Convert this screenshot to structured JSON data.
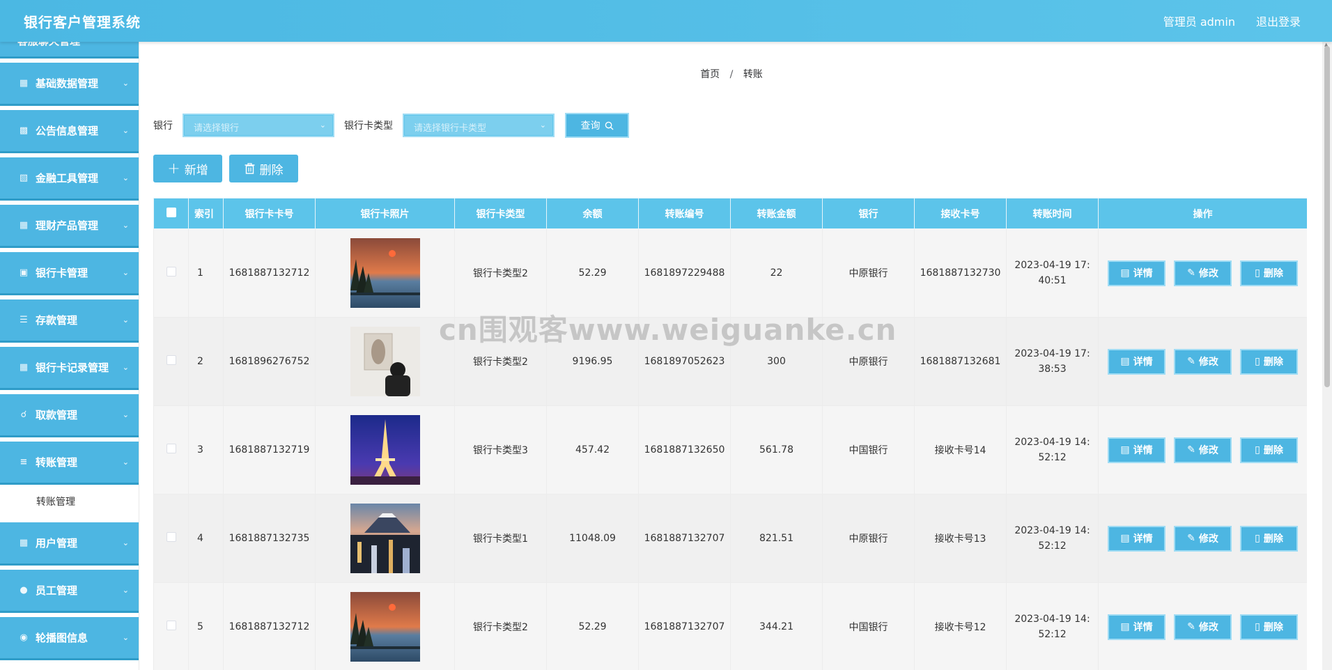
{
  "header": {
    "title": "银行客户管理系统",
    "user": "管理员 admin",
    "logout": "退出登录"
  },
  "sidebar": {
    "partial_label": "客服聊天管理",
    "items": [
      {
        "label": "基础数据管理",
        "icon": "grid-icon"
      },
      {
        "label": "公告信息管理",
        "icon": "document-icon"
      },
      {
        "label": "金融工具管理",
        "icon": "tool-icon"
      },
      {
        "label": "理财产品管理",
        "icon": "grid-icon"
      },
      {
        "label": "银行卡管理",
        "icon": "card-icon"
      },
      {
        "label": "存款管理",
        "icon": "list-icon"
      },
      {
        "label": "银行卡记录管理",
        "icon": "grid-icon"
      },
      {
        "label": "取款管理",
        "icon": "hand-icon"
      },
      {
        "label": "转账管理",
        "icon": "sliders-icon"
      },
      {
        "label": "用户管理",
        "icon": "grid-icon"
      },
      {
        "label": "员工管理",
        "icon": "user-icon"
      },
      {
        "label": "轮播图信息",
        "icon": "location-icon"
      }
    ],
    "submenu_label": "转账管理"
  },
  "breadcrumb": {
    "home": "首页",
    "sep": "/",
    "current": "转账"
  },
  "filters": {
    "bank_label": "银行",
    "bank_placeholder": "请选择银行",
    "card_type_label": "银行卡类型",
    "card_type_placeholder": "请选择银行卡类型",
    "search_label": "查询"
  },
  "actions": {
    "add": "新增",
    "delete": "删除"
  },
  "table": {
    "columns": [
      "索引",
      "银行卡卡号",
      "银行卡照片",
      "银行卡类型",
      "余额",
      "转账编号",
      "转账金额",
      "银行",
      "接收卡号",
      "转账时间",
      "操作"
    ],
    "op_labels": {
      "detail": "详情",
      "edit": "修改",
      "delete": "删除"
    },
    "rows": [
      {
        "index": "1",
        "card_no": "1681887132712",
        "photo": "sunset-lake-photo",
        "card_type": "银行卡类型2",
        "balance": "52.29",
        "transfer_no": "1681897229488",
        "amount": "22",
        "bank": "中原银行",
        "receiver": "1681887132730",
        "time": "2023-04-19 17:40:51"
      },
      {
        "index": "2",
        "card_no": "1681896276752",
        "photo": "person-gallery-photo",
        "card_type": "银行卡类型2",
        "balance": "9196.95",
        "transfer_no": "1681897052623",
        "amount": "300",
        "bank": "中原银行",
        "receiver": "1681887132681",
        "time": "2023-04-19 17:38:53"
      },
      {
        "index": "3",
        "card_no": "1681887132719",
        "photo": "eiffel-tower-photo",
        "card_type": "银行卡类型3",
        "balance": "457.42",
        "transfer_no": "1681887132650",
        "amount": "561.78",
        "bank": "中国银行",
        "receiver": "接收卡号14",
        "time": "2023-04-19 14:52:12"
      },
      {
        "index": "4",
        "card_no": "1681887132735",
        "photo": "mount-fuji-city-photo",
        "card_type": "银行卡类型1",
        "balance": "11048.09",
        "transfer_no": "1681887132707",
        "amount": "821.51",
        "bank": "中原银行",
        "receiver": "接收卡号13",
        "time": "2023-04-19 14:52:12"
      },
      {
        "index": "5",
        "card_no": "1681887132712",
        "photo": "sunset-lake-photo",
        "card_type": "银行卡类型2",
        "balance": "52.29",
        "transfer_no": "1681887132707",
        "amount": "344.21",
        "bank": "中国银行",
        "receiver": "接收卡号12",
        "time": "2023-04-19 14:52:12"
      }
    ]
  },
  "watermark": "cn围观客www.weiguanke.cn",
  "colors": {
    "primary": "#4db6e2",
    "header": "#5cc4ea",
    "border_light": "#9fdcf4"
  }
}
